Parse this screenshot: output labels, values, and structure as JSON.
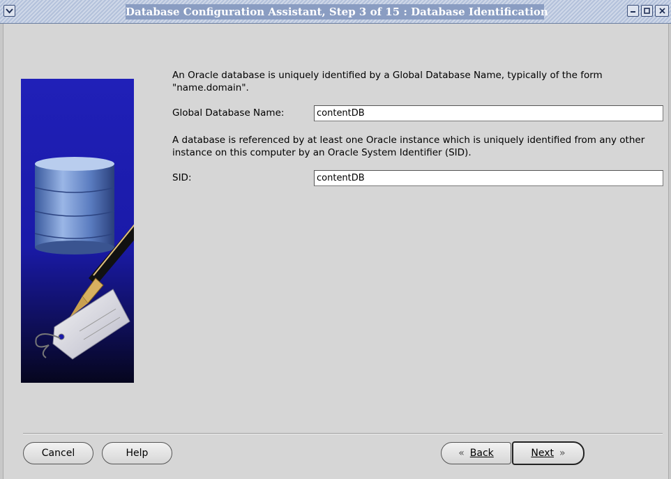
{
  "window": {
    "title": "Database Configuration Assistant, Step 3 of 15 : Database Identification"
  },
  "icons": {
    "window_menu": "chevron-down-icon",
    "minimize": "minimize-icon",
    "maximize": "maximize-icon",
    "close": "close-icon",
    "banner": "database-pen-tag-illustration"
  },
  "content": {
    "intro_text": "An Oracle database is uniquely identified by a Global Database Name, typically of the form \"name.domain\".",
    "global_db_label": "Global Database Name:",
    "global_db_value": "contentDB",
    "sid_text": "A database is referenced by at least one Oracle instance which is uniquely identified from any other instance on this computer by an Oracle System Identifier (SID).",
    "sid_label": "SID:",
    "sid_value": "contentDB"
  },
  "buttons": {
    "cancel": "Cancel",
    "help": "Help",
    "back": "Back",
    "next": "Next"
  },
  "colors": {
    "title_band": "#8a9dc2",
    "banner_blue": "#1a1aa8",
    "dialog_bg": "#d6d6d6"
  }
}
